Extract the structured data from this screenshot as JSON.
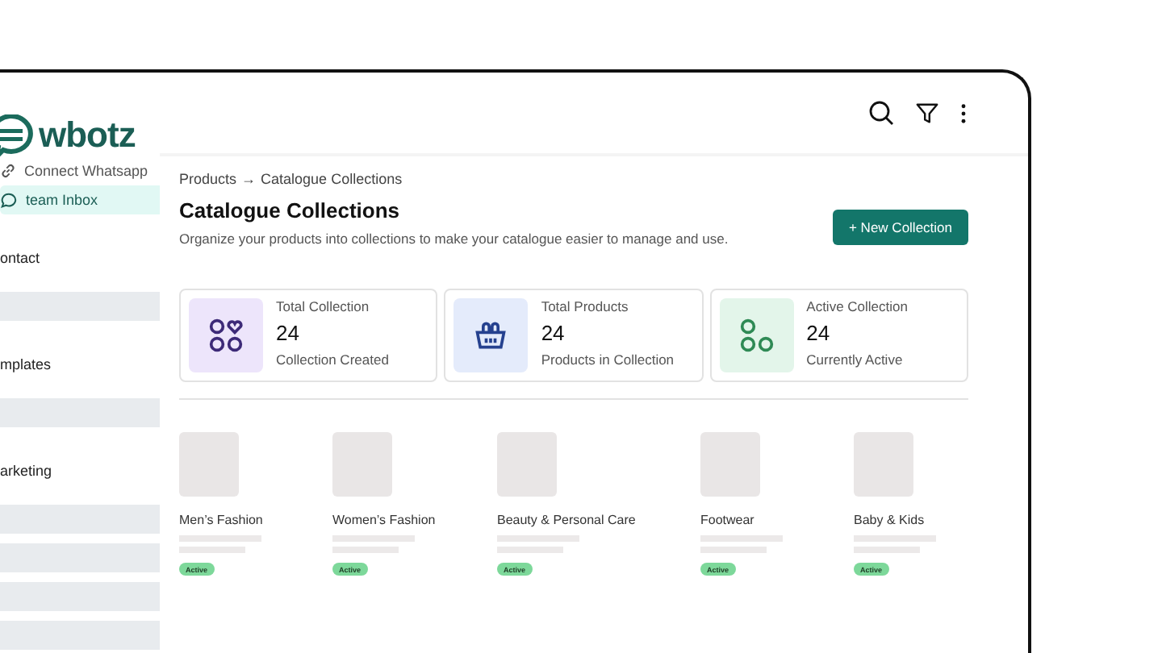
{
  "brand": {
    "name": "wbotz"
  },
  "sidebar": {
    "items": [
      {
        "label": "Connect Whatsapp",
        "selected": false
      },
      {
        "label": "team Inbox",
        "selected": true
      },
      {
        "label": "ontact",
        "selected": false
      },
      {
        "label": "mplates",
        "selected": false
      },
      {
        "label": "arketing",
        "selected": false
      }
    ]
  },
  "breadcrumb": {
    "parent": "Products",
    "separator": "→",
    "current": "Catalogue Collections"
  },
  "title": "Catalogue Collections",
  "subtitle": "Organize your products into collections to make your catalogue easier to manage and use.",
  "new_button": "+ New Collection",
  "stats": [
    {
      "label": "Total Collection",
      "value": "24",
      "caption": "Collection Created",
      "color": "#3d2a78"
    },
    {
      "label": "Total Products",
      "value": "24",
      "caption": "Products in Collection",
      "color": "#25418f"
    },
    {
      "label": "Active Collection",
      "value": "24",
      "caption": "Currently Active",
      "color": "#2f8a55"
    }
  ],
  "collections": [
    {
      "name": "Men’s Fashion",
      "status": "Active"
    },
    {
      "name": "Women’s Fashion",
      "status": "Active"
    },
    {
      "name": "Beauty & Personal Care",
      "status": "Active"
    },
    {
      "name": "Footwear",
      "status": "Active"
    },
    {
      "name": "Baby & Kids",
      "status": "Active"
    }
  ]
}
